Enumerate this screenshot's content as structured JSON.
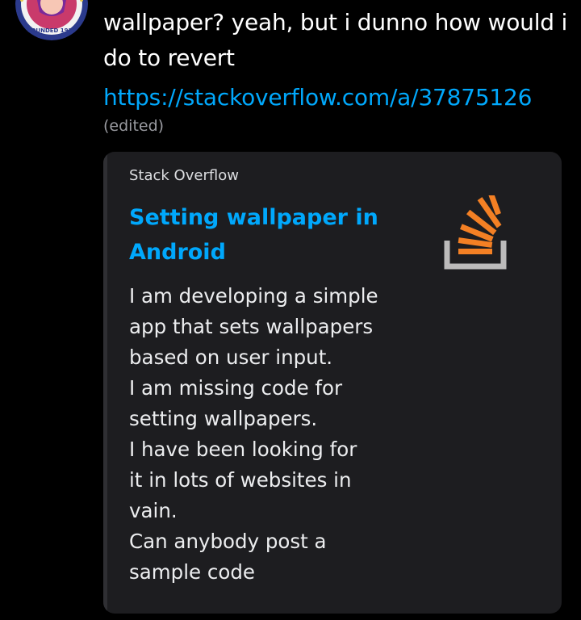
{
  "message": {
    "text": "wallpaper? yeah, but i dunno how would i do to revert",
    "link": "https://stackoverflow.com/a/37875126",
    "edited_label": "(edited)"
  },
  "embed": {
    "provider": "Stack Overflow",
    "title": "Setting wallpaper in Android",
    "description_lines": [
      "I am developing a simple",
      "app that sets wallpapers",
      "based on user input.",
      "I am missing code for",
      "setting wallpapers.",
      "I have been looking for",
      "it in lots of websites in",
      "vain.",
      "Can anybody post a",
      "sample code"
    ],
    "thumbnail_icon": "stackoverflow-logo-icon"
  },
  "avatar": {
    "badge_text": "FOUNDED 1919"
  },
  "colors": {
    "background": "#000000",
    "link": "#00a8fc",
    "embed_background": "#1d1d20",
    "so_orange": "#f48024",
    "so_gray": "#bcbbbb"
  }
}
